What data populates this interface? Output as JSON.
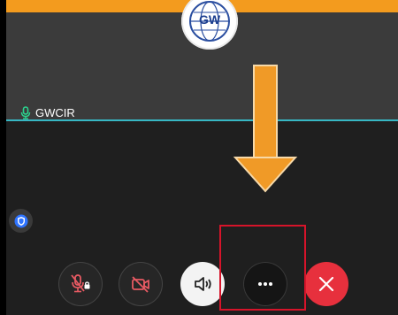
{
  "participant": {
    "name": "GWCIR",
    "avatar_text": "GW"
  },
  "colors": {
    "top_bar": "#f39b1e",
    "tile_border": "#37b7c4",
    "end_call": "#e7303d",
    "highlight": "#d6142a",
    "arrow": "#f09a27"
  },
  "icons": {
    "mic": "mic-muted-locked-icon",
    "camera": "camera-off-icon",
    "speaker": "speaker-icon",
    "more": "more-options-icon",
    "end": "close-icon",
    "shield": "shield-icon"
  }
}
